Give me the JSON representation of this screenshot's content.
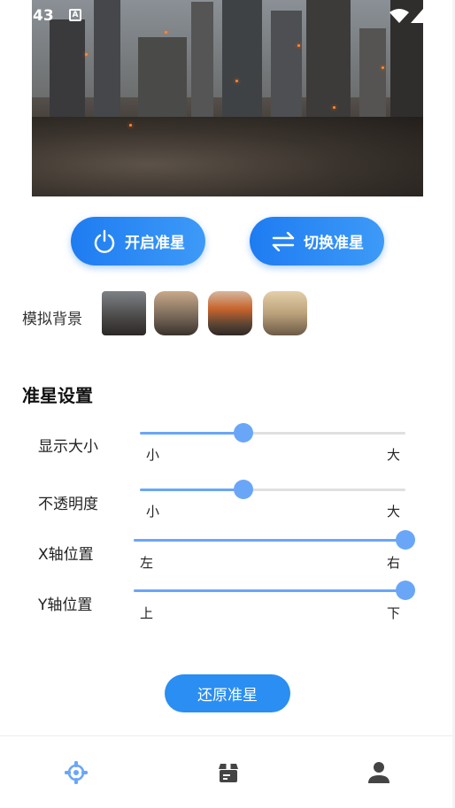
{
  "status_bar": {
    "time": "43",
    "notification_icon": "A"
  },
  "main_buttons": {
    "toggle_label": "开启准星",
    "switch_label": "切换准星"
  },
  "background": {
    "label": "模拟背景",
    "thumbnails": [
      "ruined-city",
      "wasteland-tower",
      "burning-tower",
      "desert-ruins"
    ]
  },
  "settings": {
    "title": "准星设置",
    "sliders": [
      {
        "label": "显示大小",
        "min_label": "小",
        "max_label": "大",
        "value": 0.39
      },
      {
        "label": "不透明度",
        "min_label": "小",
        "max_label": "大",
        "value": 0.39
      },
      {
        "label": "X轴位置",
        "min_label": "左",
        "max_label": "右",
        "value": 1.0
      },
      {
        "label": "Y轴位置",
        "min_label": "上",
        "max_label": "下",
        "value": 1.0
      }
    ]
  },
  "reset_label": "还原准星",
  "bottom_nav": {
    "items": [
      "crosshair-icon",
      "box-icon",
      "user-icon"
    ],
    "active_color": "#6aa6f8",
    "inactive_color": "#444444"
  },
  "colors": {
    "accent": "#1e7cf2",
    "slider": "#6aa6f8"
  }
}
